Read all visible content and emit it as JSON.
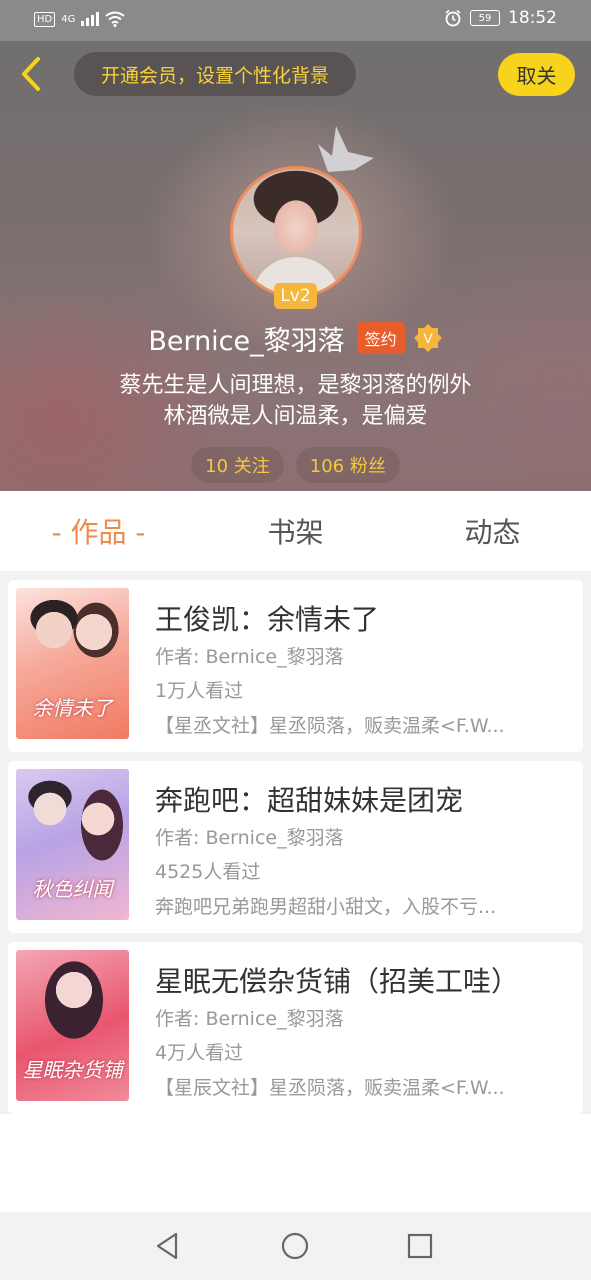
{
  "status_bar": {
    "hd": "HD",
    "network": "4G",
    "battery": "59",
    "time": "18:52"
  },
  "header": {
    "vip_prompt": "开通会员，设置个性化背景",
    "follow_label": "取关",
    "level": "Lv2",
    "username": "Bernice_黎羽落",
    "signed_badge": "签约",
    "verified_badge": "V",
    "bio_lines": [
      "蔡先生是人间理想，是黎羽落的例外",
      "林酒微是人间温柔，是偏爱"
    ],
    "following": "10 关注",
    "followers": "106 粉丝"
  },
  "tabs": [
    {
      "label": "- 作品 -",
      "active": true
    },
    {
      "label": "书架",
      "active": false
    },
    {
      "label": "动态",
      "active": false
    }
  ],
  "books": [
    {
      "title": "王俊凯：余情未了",
      "author": "作者: Bernice_黎羽落",
      "views": "1万人看过",
      "desc": "【星丞文社】星丞陨落，贩卖温柔<F.W...",
      "cover_text": "余情未了"
    },
    {
      "title": "奔跑吧：超甜妹妹是团宠",
      "author": "作者: Bernice_黎羽落",
      "views": "4525人看过",
      "desc": "奔跑吧兄弟跑男超甜小甜文，入股不亏...",
      "cover_text": "秋色纠闻"
    },
    {
      "title": "星眠无偿杂货铺（招美工哇）",
      "author": "作者: Bernice_黎羽落",
      "views": "4万人看过",
      "desc": "【星辰文社】星丞陨落，贩卖温柔<F.W...",
      "cover_text": "星眠杂货铺"
    }
  ],
  "colors": {
    "accent": "#f08a4b",
    "gold": "#f7d31b",
    "sign": "#e95c2c",
    "level": "#f4b73c"
  }
}
